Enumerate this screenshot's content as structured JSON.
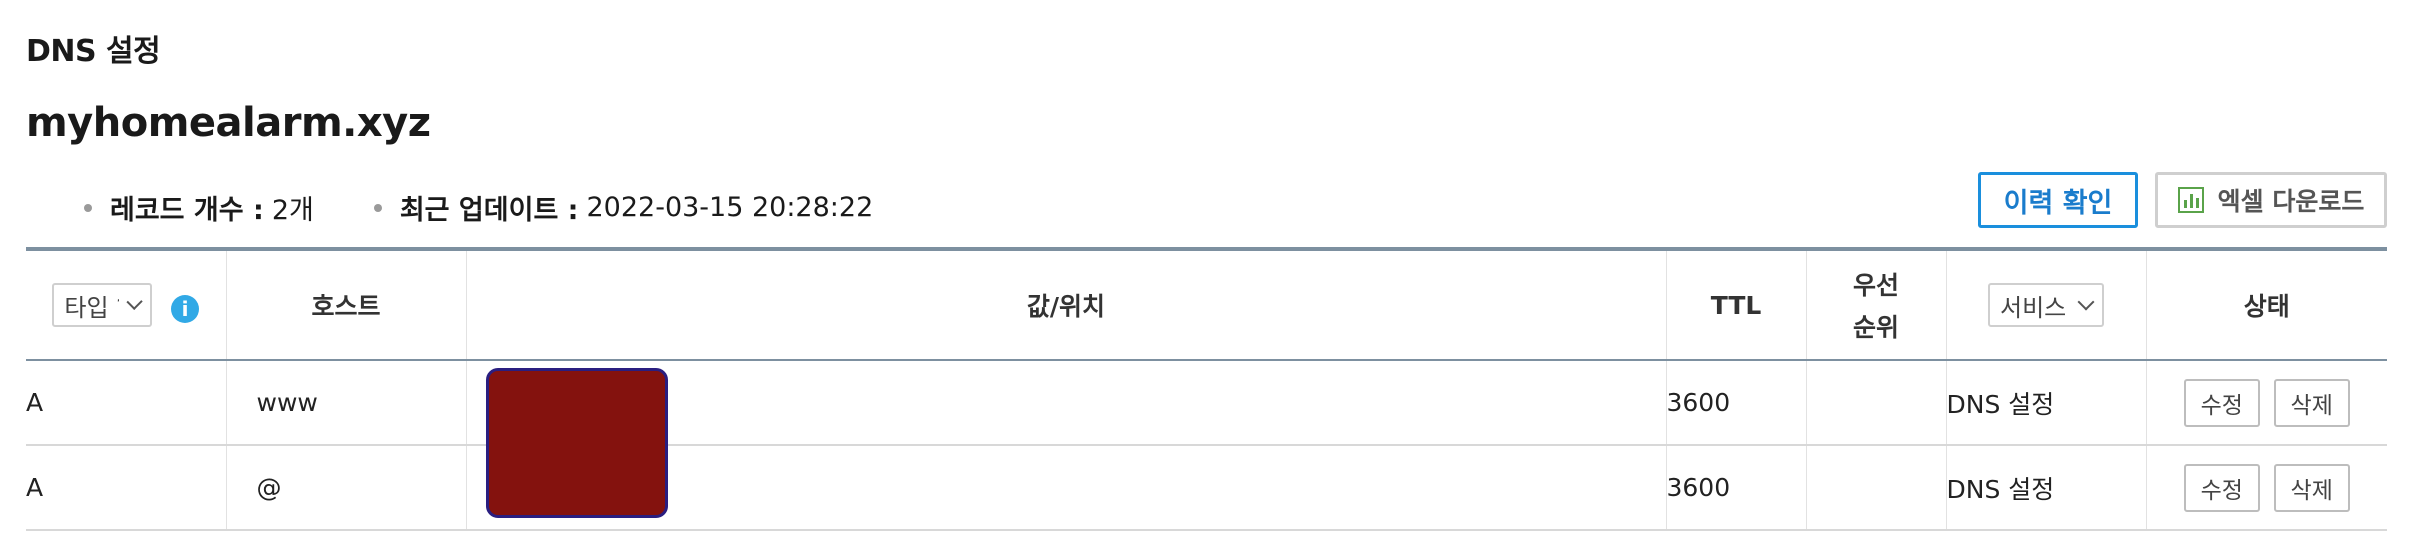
{
  "section_title": "DNS 설정",
  "domain": "myhomealarm.xyz",
  "summary": {
    "record_count_label": "레코드 개수 :",
    "record_count_value": "2개",
    "updated_label": "최근 업데이트 :",
    "updated_value": "2022-03-15 20:28:22"
  },
  "buttons": {
    "history": "이력 확인",
    "excel": "엑셀 다운로드"
  },
  "table": {
    "headers": {
      "type_select": "타입 ?",
      "info_icon_glyph": "i",
      "host": "호스트",
      "value": "값/위치",
      "ttl": "TTL",
      "priority_line1": "우선",
      "priority_line2": "순위",
      "service_select": "서비스",
      "status": "상태"
    },
    "rows": [
      {
        "type": "A",
        "host": "www",
        "ttl": "3600",
        "priority": "",
        "service": "DNS 설정",
        "edit": "수정",
        "delete": "삭제"
      },
      {
        "type": "A",
        "host": "@",
        "ttl": "3600",
        "priority": "",
        "service": "DNS 설정",
        "edit": "수정",
        "delete": "삭제"
      }
    ]
  },
  "colors": {
    "accent": "#1a8fdd",
    "redacted": "#84120e",
    "excel_icon": "#5aa34a",
    "info_icon": "#31a9e6"
  },
  "icons": [
    "info-icon",
    "excel-chart-icon",
    "chevron-down-icon"
  ]
}
